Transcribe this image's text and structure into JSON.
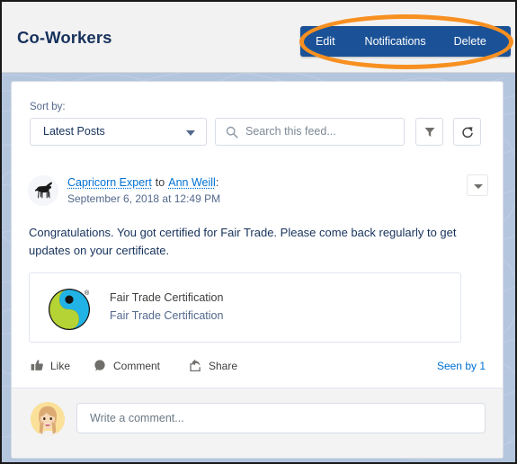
{
  "header": {
    "title": "Co-Workers",
    "actions": [
      {
        "id": "edit",
        "label": "Edit"
      },
      {
        "id": "notifications",
        "label": "Notifications"
      },
      {
        "id": "delete",
        "label": "Delete"
      }
    ],
    "action_bar_color": "#1b5297",
    "title_color": "#16325c"
  },
  "annotation": {
    "shape": "ellipse",
    "color": "#f79021",
    "target": "header action bar"
  },
  "feed": {
    "sort": {
      "label": "Sort by:",
      "selected": "Latest Posts",
      "options": [
        "Latest Posts"
      ]
    },
    "search": {
      "placeholder": "Search this feed...",
      "value": "",
      "icon": "search-icon"
    },
    "filter_button_icon": "filter-icon",
    "refresh_button_icon": "refresh-icon"
  },
  "post": {
    "avatar_icon": "goat-avatar-icon",
    "author": "Capricorn Expert",
    "preposition": "to",
    "recipient": "Ann Weill",
    "punctuation": ":",
    "timestamp": "September 6, 2018 at 12:49 PM",
    "menu_icon": "chevron-down-icon",
    "body": "Congratulations. You got certified for Fair Trade. Please come back regularly to get updates on your certificate.",
    "attachment": {
      "logo_icon": "fair-trade-logo-icon",
      "title": "Fair Trade Certification",
      "subtitle": "Fair Trade Certification",
      "logo_colors": {
        "ring": "#141414",
        "cyan": "#21b3e5",
        "green": "#b5d334"
      }
    },
    "actions": [
      {
        "id": "like",
        "label": "Like",
        "icon": "thumbs-up-icon"
      },
      {
        "id": "comment",
        "label": "Comment",
        "icon": "comment-bubble-icon"
      },
      {
        "id": "share",
        "label": "Share",
        "icon": "share-icon"
      }
    ],
    "seen_by": "Seen by 1",
    "link_color": "#0070d2"
  },
  "composer": {
    "avatar_icon": "woman-avatar-icon",
    "placeholder": "Write a comment...",
    "value": ""
  }
}
